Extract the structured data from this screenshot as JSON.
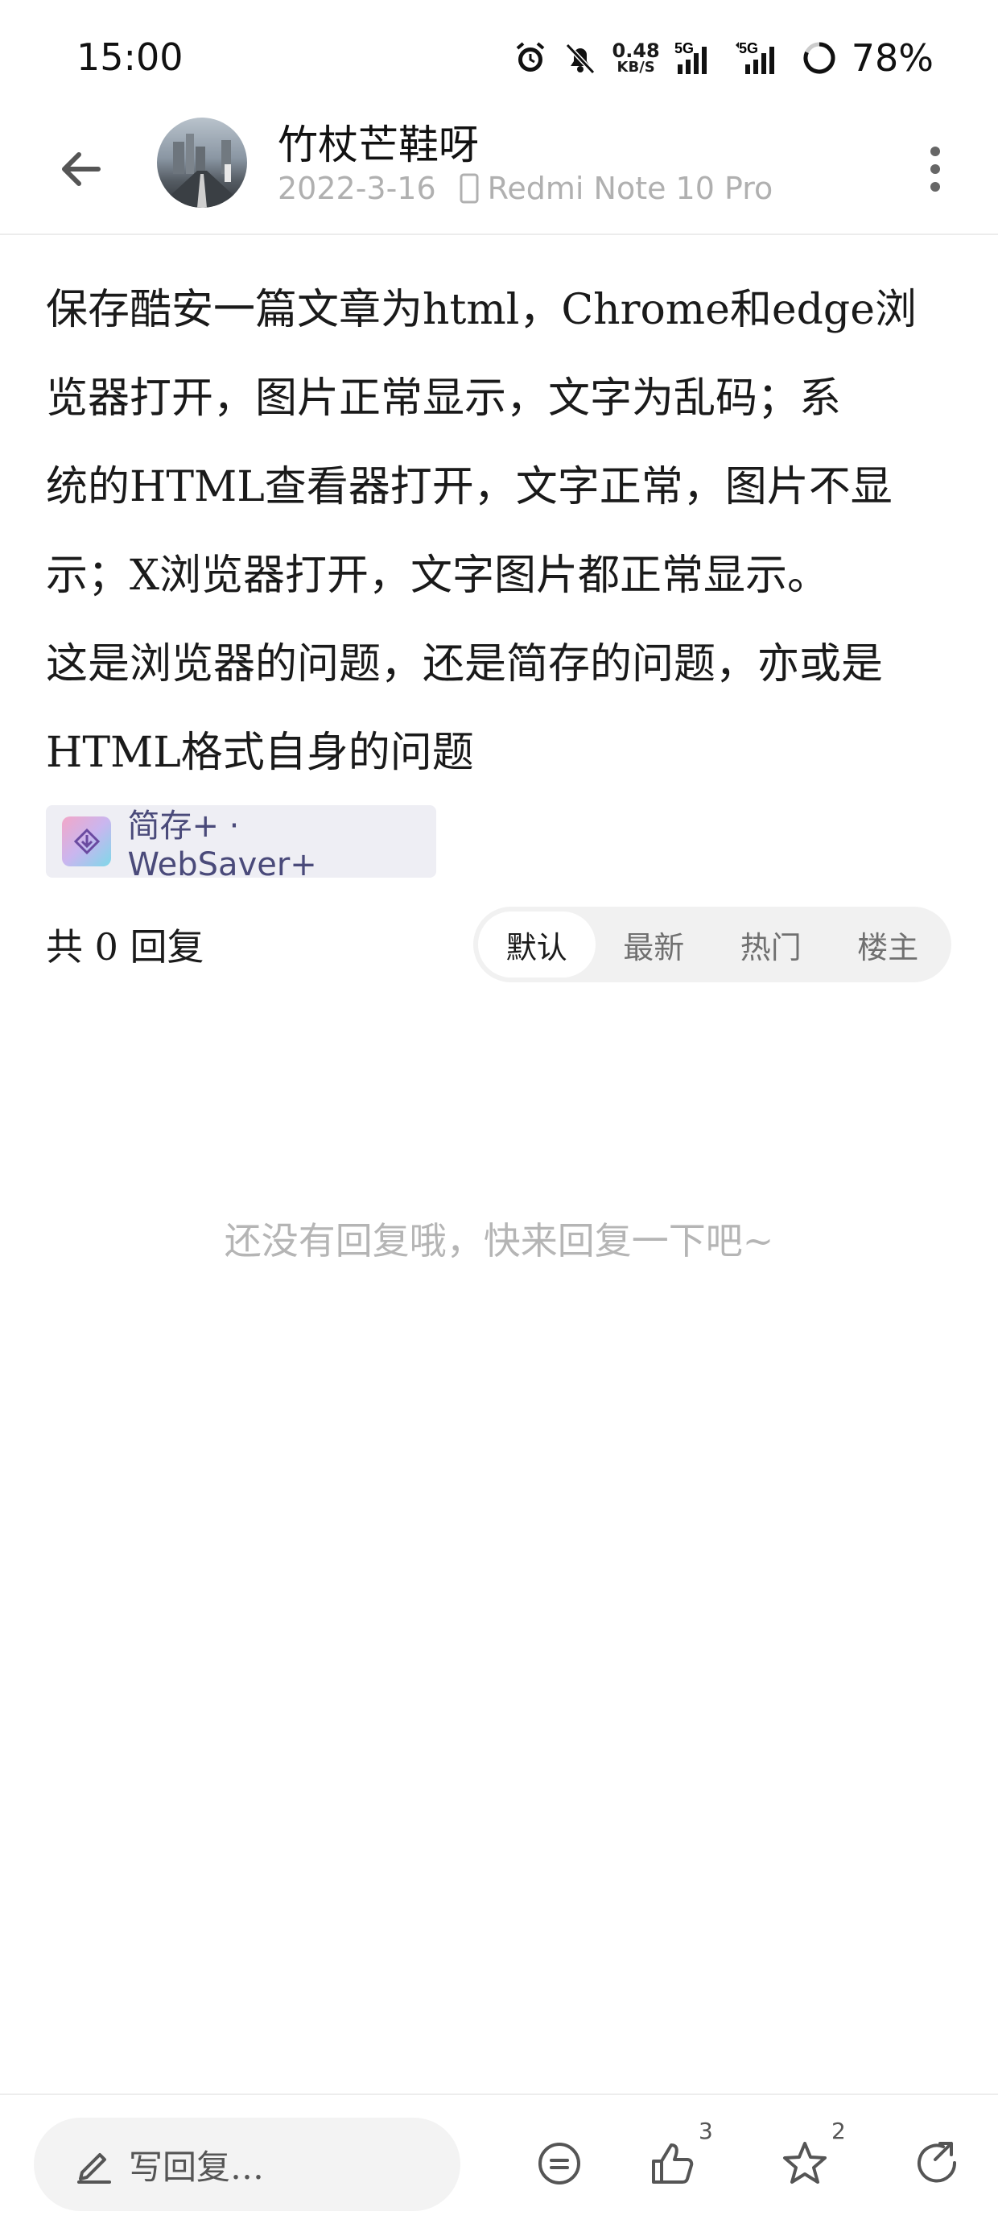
{
  "status_bar": {
    "time": "15:00",
    "net_speed_value": "0.48",
    "net_speed_unit": "KB/S",
    "sim1": "5G",
    "sim2": "5G",
    "battery": "78%"
  },
  "header": {
    "username": "竹杖芒鞋呀",
    "date": "2022-3-16",
    "device": "Redmi Note 10 Pro"
  },
  "article": {
    "lines": [
      "保存酷安一篇文章为html，Chrome和edge浏",
      "览器打开，图片正常显示，文字为乱码；系",
      "统的HTML查看器打开，文字正常，图片不显",
      "示；X浏览器打开，文字图片都正常显示。",
      "这是浏览器的问题，还是简存的问题，亦或是",
      "HTML格式自身的问题"
    ]
  },
  "tag": {
    "label": "简存+ · WebSaver+"
  },
  "replies": {
    "count_label": "共 0 回复",
    "sort_tabs": [
      "默认",
      "最新",
      "热门",
      "楼主"
    ],
    "active_tab": "默认",
    "empty_message": "还没有回复哦，快来回复一下吧~"
  },
  "bottom_bar": {
    "reply_placeholder": "写回复…",
    "like_count": "3",
    "star_count": "2"
  },
  "icons": {
    "back": "back-arrow-icon",
    "more": "more-vertical-icon",
    "device": "phone-icon",
    "alarm": "alarm-icon",
    "mute": "bell-off-icon",
    "signal": "signal-icon",
    "battery": "battery-ring-icon",
    "edit": "pencil-icon",
    "comment": "comment-icon",
    "like": "thumbs-up-icon",
    "star": "star-icon",
    "share": "share-icon"
  }
}
